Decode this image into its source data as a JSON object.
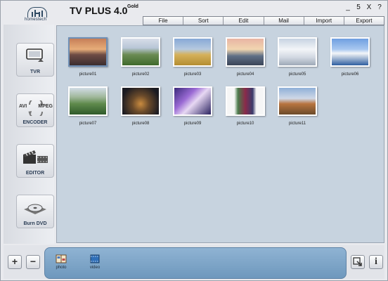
{
  "header": {
    "logo_text": "homestech",
    "title": "TV PLUS 4.0",
    "title_superscript": "Gold",
    "window_controls": [
      "_",
      "5",
      "X",
      "?"
    ]
  },
  "menu": [
    "File",
    "Sort",
    "Edit",
    "Mail",
    "Import",
    "Export"
  ],
  "sidebar": [
    {
      "label": "TVR",
      "icon": "tv-icon"
    },
    {
      "label": "ENCODER",
      "icon": "encoder-icon",
      "sub_left": "AVI",
      "sub_right": "MPEG"
    },
    {
      "label": "EDITOR",
      "icon": "clapperboard-icon"
    },
    {
      "label": "Burn DVD",
      "icon": "dvd-icon"
    }
  ],
  "pictures": [
    {
      "caption": "picture01",
      "scene": "sunset-road",
      "selected": true
    },
    {
      "caption": "picture02",
      "scene": "tree-field"
    },
    {
      "caption": "picture03",
      "scene": "wheel-field"
    },
    {
      "caption": "picture04",
      "scene": "lake-sunset"
    },
    {
      "caption": "picture05",
      "scene": "snow-mountain"
    },
    {
      "caption": "picture06",
      "scene": "harbor"
    },
    {
      "caption": "picture07",
      "scene": "tea-hills"
    },
    {
      "caption": "picture08",
      "scene": "city-night"
    },
    {
      "caption": "picture09",
      "scene": "dancers"
    },
    {
      "caption": "picture10",
      "scene": "portrait"
    },
    {
      "caption": "picture11",
      "scene": "pagoda"
    }
  ],
  "tray": [
    {
      "label": "photo",
      "icon": "photo-album-icon"
    },
    {
      "label": "video",
      "icon": "video-icon"
    }
  ],
  "bottom_buttons": {
    "add": "+",
    "remove": "−",
    "export": "↳",
    "info": "i"
  }
}
